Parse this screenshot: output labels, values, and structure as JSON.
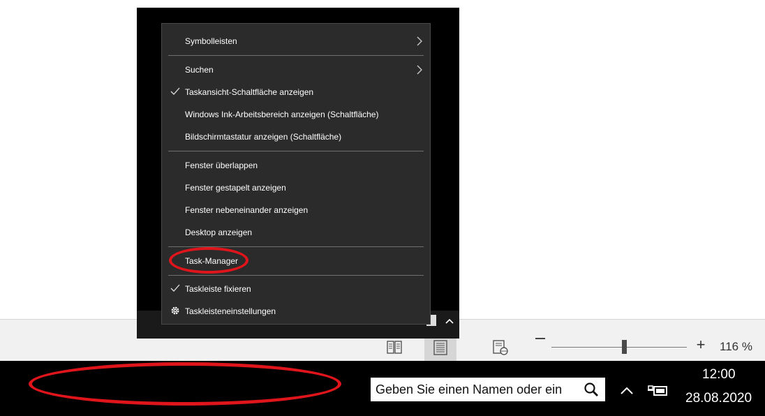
{
  "context_menu": {
    "items": [
      {
        "label": "Symbolleisten",
        "checked": false,
        "has_submenu": true
      },
      {
        "label": "Suchen",
        "checked": false,
        "has_submenu": true
      },
      {
        "label": "Taskansicht-Schaltfläche anzeigen",
        "checked": true,
        "has_submenu": false
      },
      {
        "label": "Windows Ink-Arbeitsbereich anzeigen (Schaltfläche)",
        "checked": false,
        "has_submenu": false
      },
      {
        "label": "Bildschirmtastatur anzeigen (Schaltfläche)",
        "checked": false,
        "has_submenu": false
      },
      {
        "label": "Fenster überlappen",
        "checked": false,
        "has_submenu": false
      },
      {
        "label": "Fenster gestapelt anzeigen",
        "checked": false,
        "has_submenu": false
      },
      {
        "label": "Fenster nebeneinander anzeigen",
        "checked": false,
        "has_submenu": false
      },
      {
        "label": "Desktop anzeigen",
        "checked": false,
        "has_submenu": false
      },
      {
        "label": "Task-Manager",
        "checked": false,
        "has_submenu": false,
        "highlighted": true
      },
      {
        "label": "Taskleiste fixieren",
        "checked": true,
        "has_submenu": false
      },
      {
        "label": "Taskleisteneinstellungen",
        "checked": false,
        "has_submenu": false,
        "icon": "gear-icon"
      }
    ]
  },
  "statusbar": {
    "views": [
      "reading-view-icon",
      "print-layout-icon",
      "web-layout-icon"
    ],
    "active_view": "print-layout-icon",
    "zoom_level": "116 %",
    "zoom_fraction": 0.52
  },
  "taskbar": {
    "search_text": "Geben Sie einen Namen oder ein",
    "time": "12:00",
    "date": "28.08.2020"
  },
  "colors": {
    "menu_bg": "#2b2b2b",
    "taskbar_bg": "#000000",
    "highlight_oval": "#e0151b",
    "statusbar_bg": "#f1f1f1"
  }
}
